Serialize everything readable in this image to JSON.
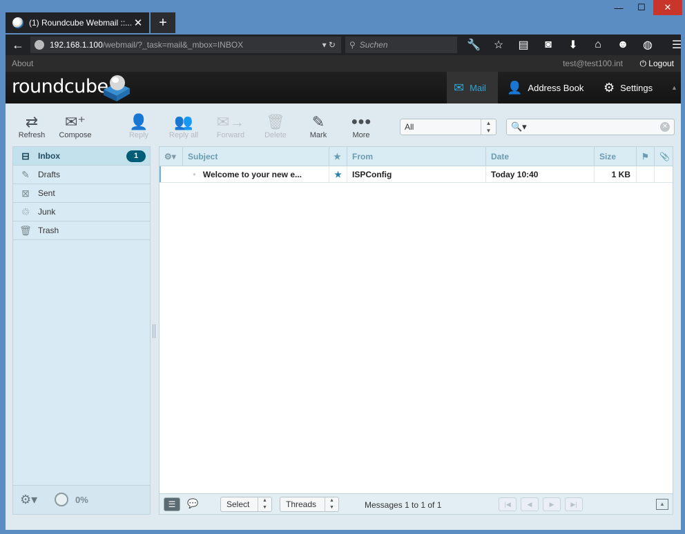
{
  "browser": {
    "tab_title": "(1) Roundcube Webmail ::...",
    "url_host": "192.168.1.100",
    "url_path": "/webmail/?_task=mail&_mbox=INBOX",
    "search_placeholder": "Suchen"
  },
  "topline": {
    "about": "About",
    "user": "test@test100.int",
    "logout": "Logout"
  },
  "header": {
    "logo": "roundcube",
    "tasks": [
      "Mail",
      "Address Book",
      "Settings"
    ]
  },
  "toolbar": {
    "refresh": "Refresh",
    "compose": "Compose",
    "reply": "Reply",
    "reply_all": "Reply all",
    "forward": "Forward",
    "delete": "Delete",
    "mark": "Mark",
    "more": "More",
    "filter": "All"
  },
  "folders": {
    "items": [
      {
        "name": "Inbox",
        "icon": "inbox-icon",
        "unread": "1"
      },
      {
        "name": "Drafts",
        "icon": "pencil-icon"
      },
      {
        "name": "Sent",
        "icon": "sent-icon"
      },
      {
        "name": "Junk",
        "icon": "junk-icon"
      },
      {
        "name": "Trash",
        "icon": "trash-icon"
      }
    ],
    "quota": "0%"
  },
  "list": {
    "columns": {
      "subject": "Subject",
      "from": "From",
      "date": "Date",
      "size": "Size"
    },
    "messages": [
      {
        "subject": "Welcome to your new e...",
        "from": "ISPConfig",
        "date": "Today 10:40",
        "size": "1 KB"
      }
    ],
    "footer": {
      "select": "Select",
      "threads": "Threads",
      "count": "Messages 1 to 1 of 1"
    }
  },
  "colors": {
    "accent": "#2ea5d6",
    "badge": "#005d77"
  }
}
